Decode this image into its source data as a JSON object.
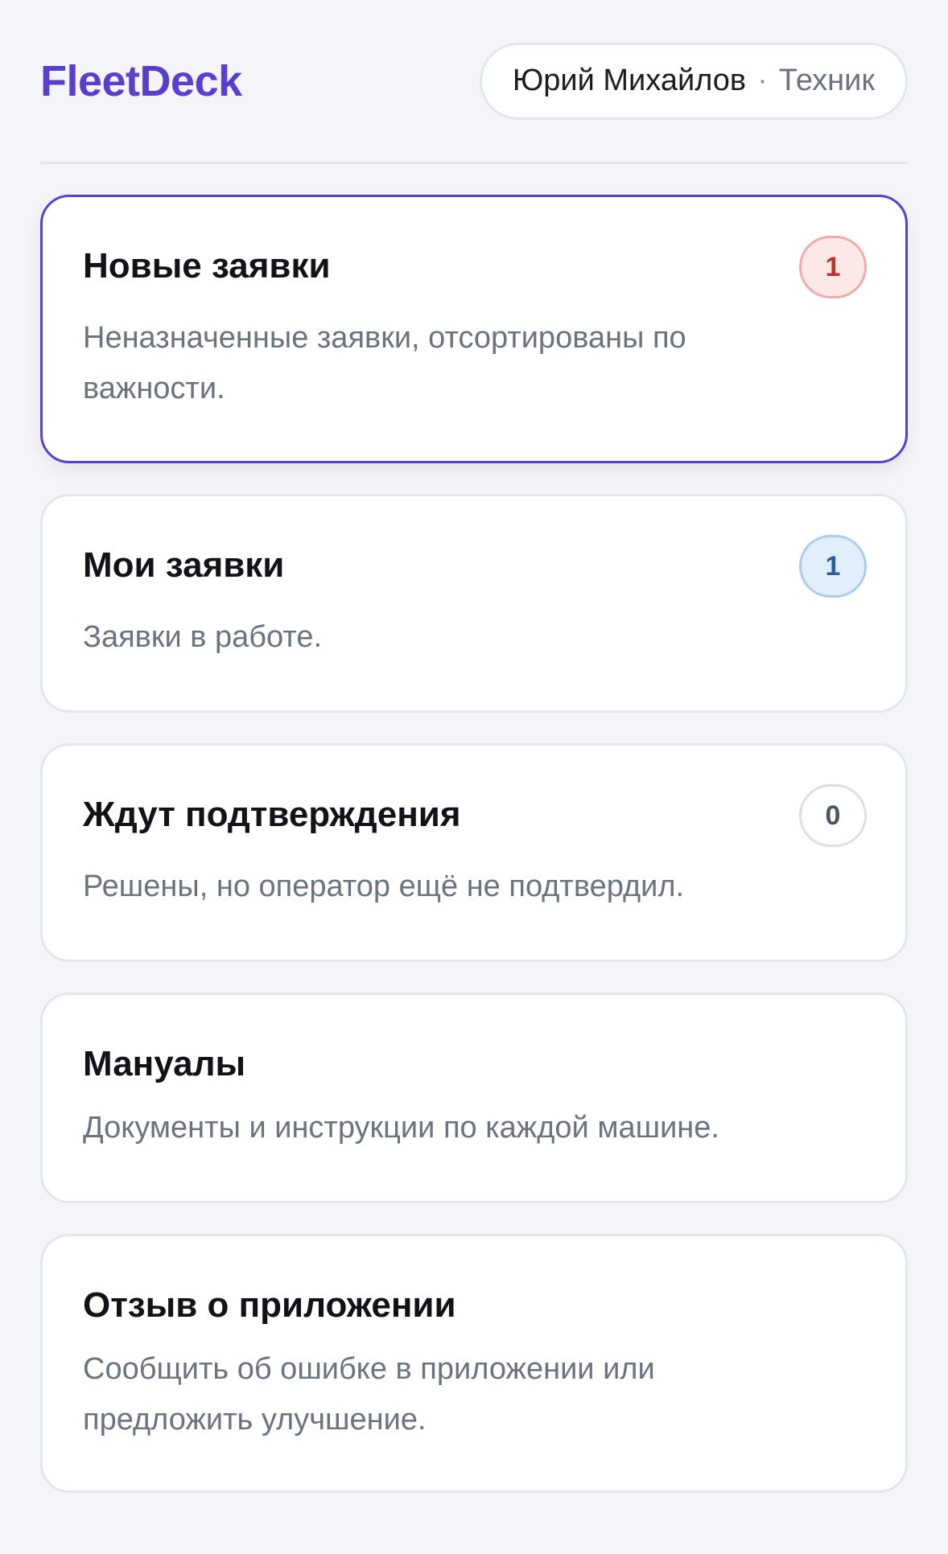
{
  "header": {
    "logo": "FleetDeck",
    "user_name": "Юрий Михайлов",
    "separator": "·",
    "user_role": "Техник"
  },
  "cards": [
    {
      "title": "Новые заявки",
      "description": "Неназначенные заявки, отсортированы по важности.",
      "badge": "1",
      "badge_color": "#c0312e",
      "active": true
    },
    {
      "title": "Мои заявки",
      "description": "Заявки в работе.",
      "badge": "1",
      "badge_color": "#2d5d9a"
    },
    {
      "title": "Ждут подтверждения",
      "description": "Решены, но оператор ещё не подтвердил.",
      "badge": "0",
      "badge_color": "#4b5563"
    },
    {
      "title": "Мануалы",
      "description": "Документы и инструкции по каждой машине."
    },
    {
      "title": "Отзыв о приложении",
      "description": "Сообщить об ошибке в приложении или предложить улучшение."
    }
  ],
  "colors": {
    "accent": "#5a3fcf",
    "background": "#f4f5f9"
  }
}
